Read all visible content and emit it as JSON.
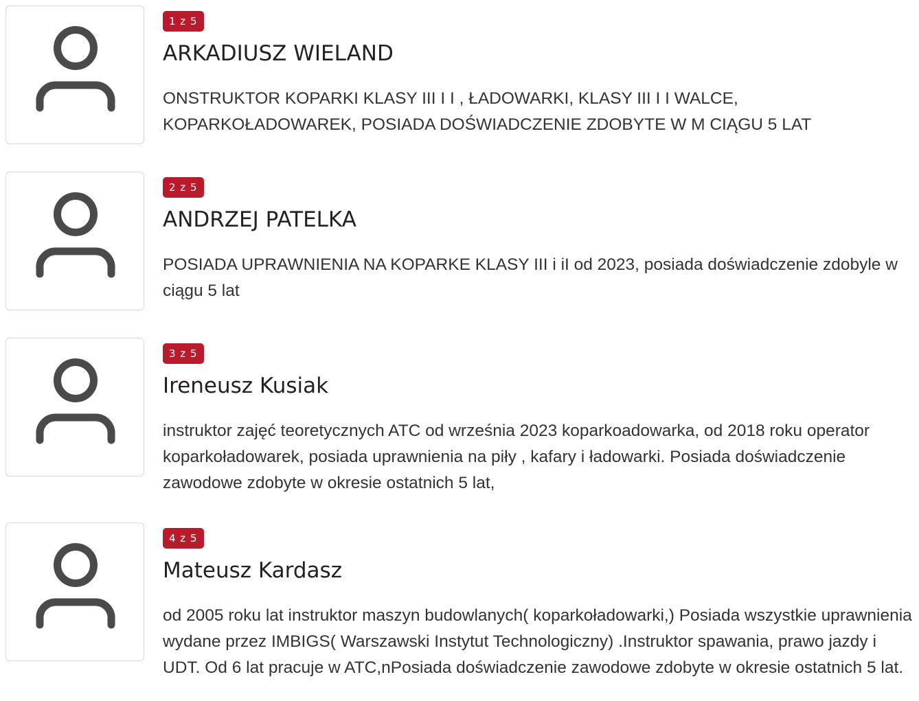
{
  "instructors": [
    {
      "badge": "1 z 5",
      "name": "ARKADIUSZ WIELAND",
      "description": "ONSTRUKTOR KOPARKI KLASY III I I , ŁADOWARKI, KLASY III I I WALCE, KOPARKOŁADOWAREK, POSIADA DOŚWIADCZENIE ZDOBYTE W M CIĄGU 5 LAT",
      "avatar_icon": "user-icon"
    },
    {
      "badge": "2 z 5",
      "name": "ANDRZEJ PATELKA",
      "description": "POSIADA UPRAWNIENIA NA KOPARKE KLASY III i iI od 2023, posiada doświadczenie zdobyle w ciągu 5 lat",
      "avatar_icon": "user-icon"
    },
    {
      "badge": "3 z 5",
      "name": "Ireneusz Kusiak",
      "description": "instruktor zajęć teoretycznych ATC od września 2023 koparkoadowarka, od 2018 roku operator koparkoładowarek, posiada uprawnienia na piły , kafary i ładowarki. Posiada doświadczenie zawodowe zdobyte w okresie ostatnich 5 lat,",
      "avatar_icon": "user-icon"
    },
    {
      "badge": "4 z 5",
      "name": "Mateusz Kardasz",
      "description": "od 2005 roku lat instruktor maszyn budowlanych( koparkoładowarki,) Posiada wszystkie uprawnienia wydane przez IMBIGS( Warszawski Instytut Technologiczny) .Instruktor spawania, prawo jazdy i UDT. Od 6 lat pracuje w ATC,nPosiada doświadczenie zawodowe zdobyte w okresie ostatnich 5 lat.",
      "avatar_icon": "user-icon"
    }
  ],
  "colors": {
    "badge_background": "#b81c2c",
    "badge_text": "#ffffff",
    "avatar_icon": "#4a4a4a",
    "avatar_border": "#d9d9d9"
  }
}
